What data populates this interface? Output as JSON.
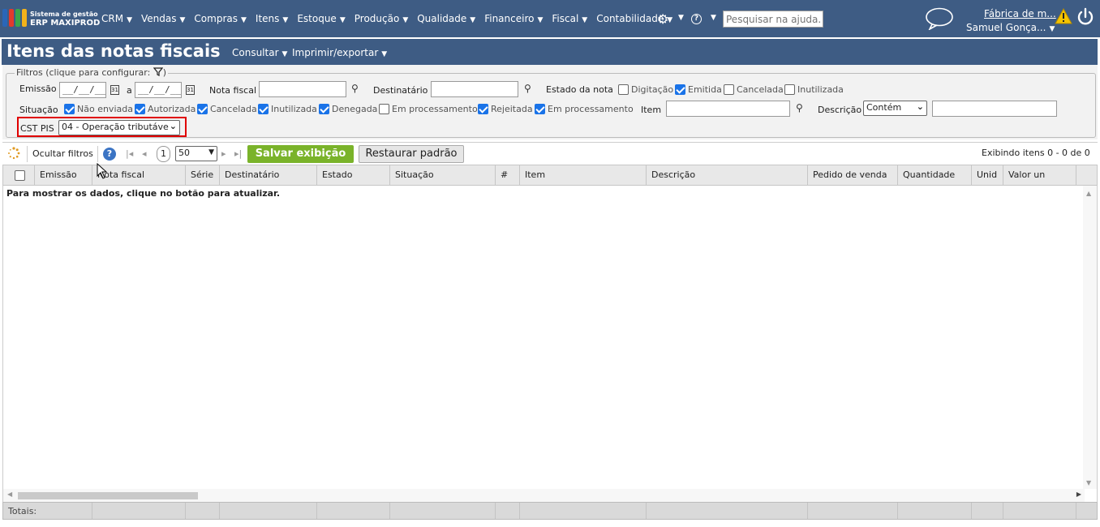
{
  "app": {
    "logo_line1": "Sistema de gestão",
    "logo_line2": "ERP MAXIPROD",
    "nav": [
      "CRM",
      "Vendas",
      "Compras",
      "Itens",
      "Estoque",
      "Produção",
      "Qualidade",
      "Financeiro",
      "Fiscal",
      "Contabilidade"
    ],
    "search_placeholder": "Pesquisar na ajuda...",
    "company": "Fábrica de m...",
    "user": "Samuel Gonça..."
  },
  "page": {
    "title": "Itens das notas fiscais",
    "menus": [
      "Consultar",
      "Imprimir/exportar"
    ]
  },
  "filters": {
    "legend": "Filtros (clique para configurar:",
    "emissao_label": "Emissão",
    "date_from": "__/__/__",
    "date_to": "__/__/__",
    "a_label": "a",
    "nota_fiscal_label": "Nota fiscal",
    "destinatario_label": "Destinatário",
    "estado_label": "Estado da nota",
    "estado": [
      {
        "label": "Digitação",
        "checked": false
      },
      {
        "label": "Emitida",
        "checked": true
      },
      {
        "label": "Cancelada",
        "checked": false
      },
      {
        "label": "Inutilizada",
        "checked": false
      }
    ],
    "situacao_label": "Situação",
    "situacao": [
      {
        "label": "Não enviada",
        "checked": true
      },
      {
        "label": "Autorizada",
        "checked": true
      },
      {
        "label": "Cancelada",
        "checked": true
      },
      {
        "label": "Inutilizada",
        "checked": true
      },
      {
        "label": "Denegada",
        "checked": true
      },
      {
        "label": "Em processamento",
        "checked": false
      },
      {
        "label": "Rejeitada",
        "checked": true
      },
      {
        "label": "Em processamento",
        "checked": true
      }
    ],
    "item_label": "Item",
    "descricao_label": "Descrição",
    "descricao_mode": "Contém",
    "cst_pis_label": "CST PIS",
    "cst_pis_value": "04 - Operação tributáve"
  },
  "toolbar": {
    "hide_filters": "Ocultar filtros",
    "page_number": "1",
    "page_size": "50",
    "save_view": "Salvar exibição",
    "restore_default": "Restaurar padrão",
    "showing": "Exibindo itens 0 - 0 de 0"
  },
  "grid": {
    "columns": [
      "Emissão",
      "Nota fiscal",
      "Série",
      "Destinatário",
      "Estado",
      "Situação",
      "#",
      "Item",
      "Descrição",
      "Pedido de venda",
      "Quantidade",
      "Unid",
      "Valor un"
    ],
    "empty_message": "Para mostrar os dados, clique no botão para atualizar.",
    "totals_label": "Totais:"
  },
  "colors": {
    "header_bg": "#3e5c84",
    "save_green": "#7ab32a",
    "check_blue": "#1a73e8",
    "highlight_red": "#e00000"
  }
}
